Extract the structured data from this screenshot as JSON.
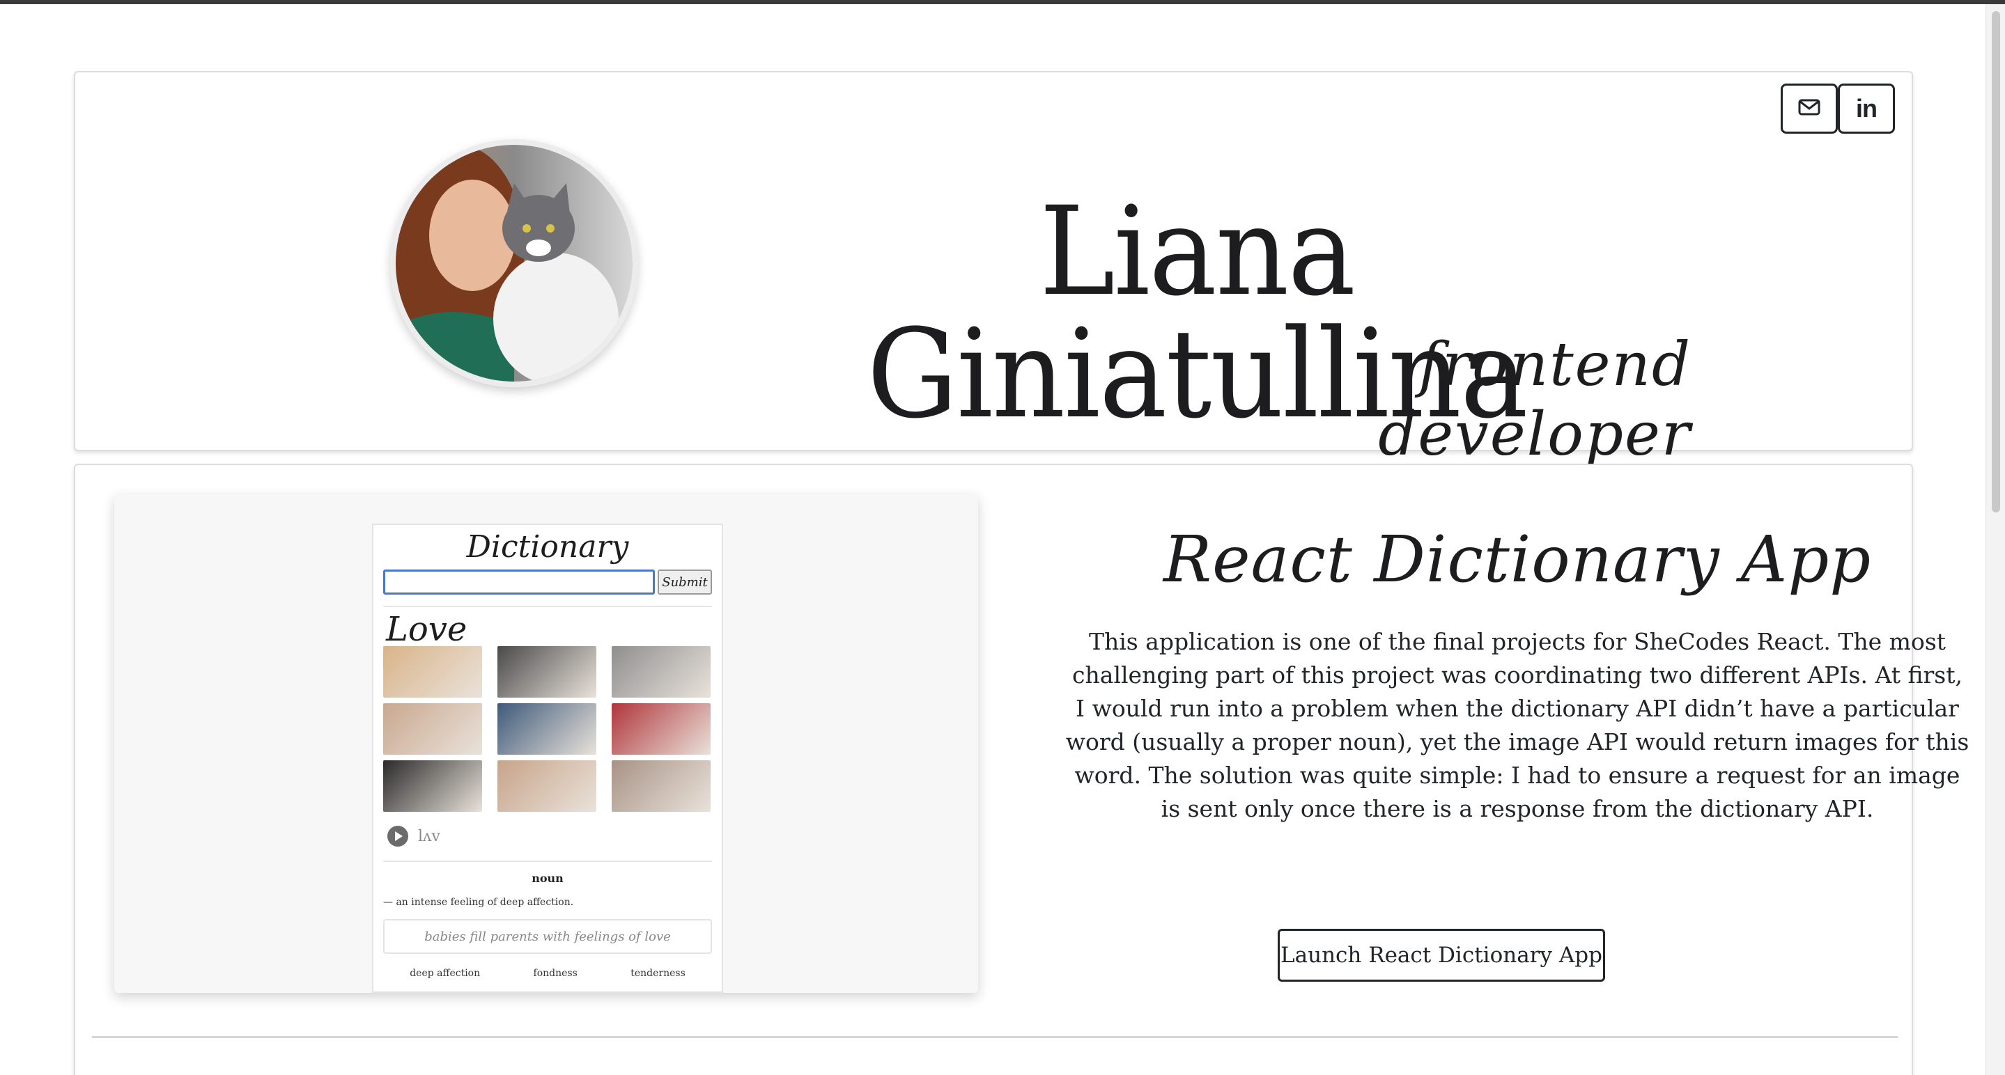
{
  "header": {
    "name": "Liana Giniatullina",
    "role": "frontend developer",
    "social": [
      {
        "icon": "envelope-icon",
        "label": "email"
      },
      {
        "icon": "linkedin-icon",
        "label": "in"
      }
    ]
  },
  "project": {
    "title": "React Dictionary App",
    "description": "This application is one of the final projects for SheCodes React. The most challenging part of this project was coordinating two different APIs. At first, I would run into a problem when the dictionary API didn’t have a particular word (usually a proper noun), yet the image API would return images for this word. The solution was quite simple: I had to ensure a request for an image is sent only once there is a response from the dictionary API.",
    "launch_label": "Launch React Dictionary App",
    "preview": {
      "title": "Dictionary",
      "submit_label": "Submit",
      "word": "Love",
      "phonetic": "lʌv",
      "part_of_speech": "noun",
      "definition": "— an intense feeling of deep affection.",
      "example": "babies fill parents with feelings of love",
      "synonyms": [
        "deep affection",
        "fondness",
        "tenderness"
      ],
      "thumb_colors": [
        "#d9b48a",
        "#4a4a4a",
        "#8f8f8f",
        "#c9a88f",
        "#3e5a7a",
        "#b0363b",
        "#2a2a2a",
        "#c7a48a",
        "#a89386"
      ]
    }
  },
  "colors": {
    "text": "#212529",
    "card_border": "#dcdcdc",
    "input_focus": "#4a78c8"
  }
}
